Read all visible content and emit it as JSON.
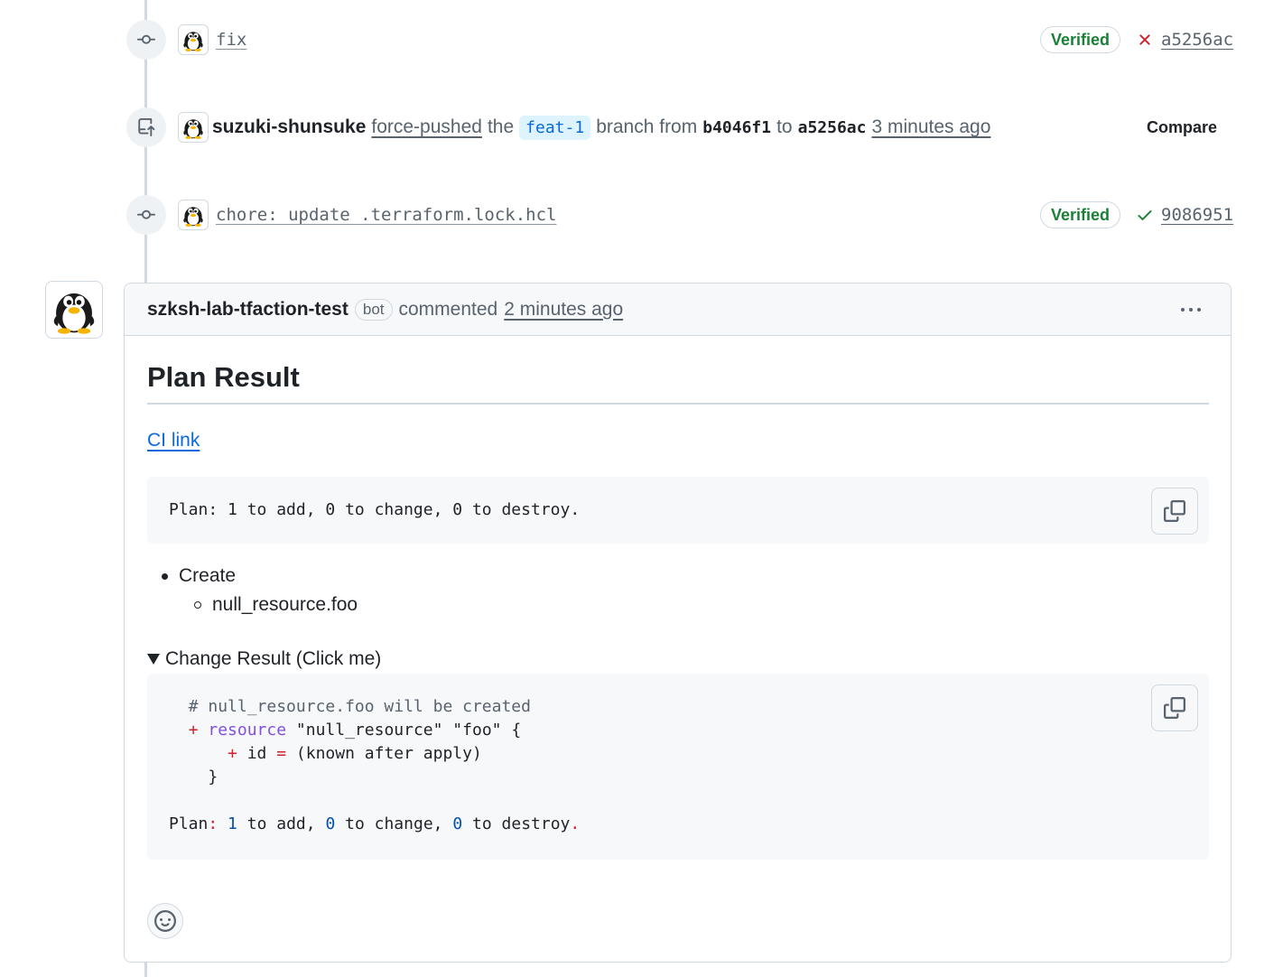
{
  "timeline": {
    "commit_1": {
      "message": "fix",
      "verified_label": "Verified",
      "status": "failure",
      "sha": "a5256ac"
    },
    "force_push": {
      "author": "suzuki-shunsuke",
      "action": "force-pushed",
      "the": "the",
      "branch": "feat-1",
      "branch_from": "branch from",
      "from_sha": "b4046f1",
      "to": "to",
      "to_sha": "a5256ac",
      "time": "3 minutes ago",
      "compare_label": "Compare"
    },
    "commit_2": {
      "message": "chore: update .terraform.lock.hcl",
      "verified_label": "Verified",
      "status": "success",
      "sha": "9086951"
    }
  },
  "comment": {
    "author": "szksh-lab-tfaction-test",
    "bot_label": "bot",
    "action": "commented",
    "time": "2 minutes ago",
    "title": "Plan Result",
    "ci_link": "CI link",
    "plan_summary": "Plan: 1 to add, 0 to change, 0 to destroy.",
    "list": {
      "item": "Create",
      "subitem": "null_resource.foo"
    },
    "details_summary": "Change Result (Click me)",
    "code": {
      "comment_line": "# null_resource.foo will be created",
      "plus": "+",
      "keyword": "resource",
      "resource_args": " \"null_resource\" \"foo\" {",
      "attr_name": " id ",
      "equals": "=",
      "attr_value": " (known after apply)",
      "close": "}",
      "plan_label": "Plan",
      "colon": ":",
      "add_count": "1",
      "to_add": " to add, ",
      "change_count": "0",
      "to_change": " to change, ",
      "destroy_count": "0",
      "to_destroy": " to destroy",
      "period": "."
    }
  },
  "icons": {
    "commit": "git-commit-icon",
    "force_push": "repo-push-icon",
    "copy": "copy-icon",
    "emoji": "smiley-icon",
    "failure": "x-icon",
    "success": "check-icon",
    "menu": "kebab-horizontal-icon",
    "avatar": "penguin-avatar"
  },
  "colors": {
    "verified_green": "#1a7f37",
    "failure_red": "#cf222e",
    "link_blue": "#0969da",
    "branch_chip_bg": "#ddf4ff",
    "muted": "#59636e",
    "border": "#d1d9e0"
  }
}
